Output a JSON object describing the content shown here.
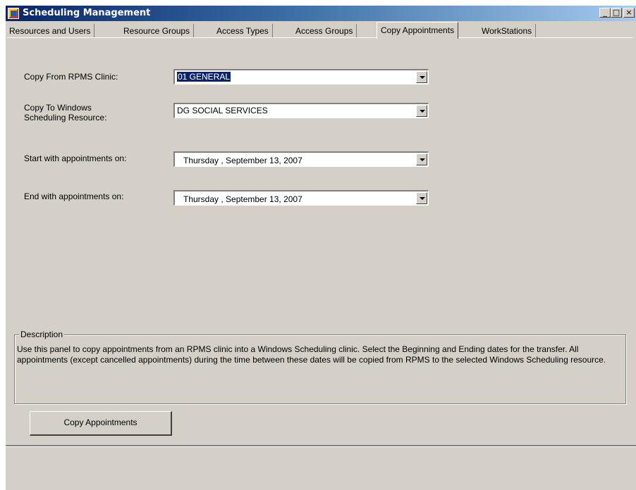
{
  "window": {
    "title": "Scheduling Management",
    "controls": {
      "minimize": "_",
      "maximize": "□",
      "close": "×"
    }
  },
  "tabs": [
    {
      "label": "Resources and Users"
    },
    {
      "label": "Resource Groups"
    },
    {
      "label": "Access Types"
    },
    {
      "label": "Access Groups"
    },
    {
      "label": "Copy Appointments"
    },
    {
      "label": "WorkStations"
    }
  ],
  "active_tab": "Copy Appointments",
  "form": {
    "copy_from_label": "Copy From RPMS Clinic:",
    "copy_from_value": "01 GENERAL",
    "copy_to_label_line1": "Copy To Windows",
    "copy_to_label_line2": "Scheduling Resource:",
    "copy_to_value": "DG SOCIAL SERVICES",
    "start_label": "Start with appointments on:",
    "start_value": "Thursday  , September 13, 2007",
    "end_label": "End with appointments on:",
    "end_value": "Thursday  , September 13, 2007"
  },
  "description": {
    "title": "Description",
    "text": "Use this panel to copy appointments from an RPMS clinic into a Windows Scheduling clinic.  Select the Beginning and Ending dates for the transfer.  All appointments (except cancelled appointments) during the time between these dates will be copied from RPMS to the selected Windows Scheduling resource."
  },
  "actions": {
    "copy_button": "Copy Appointments"
  },
  "colors": {
    "face": "#d4d0c8",
    "title_start": "#0a246a",
    "selection": "#0a246a"
  }
}
